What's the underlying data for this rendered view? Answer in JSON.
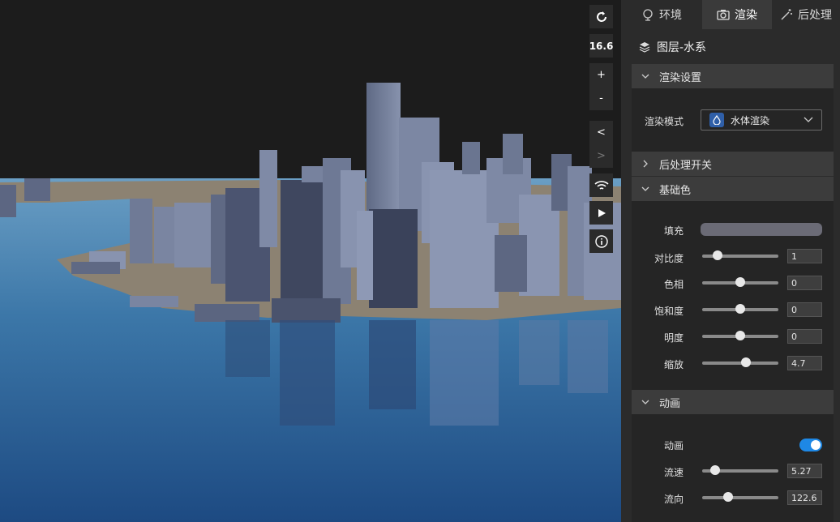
{
  "toolbar": {
    "zoom_level": "16.6",
    "zoom_in": "+",
    "zoom_out": "-",
    "prev": "<",
    "next": ">"
  },
  "tabs": [
    {
      "label": "环境",
      "icon": "globe-icon"
    },
    {
      "label": "渲染",
      "icon": "camera-icon"
    },
    {
      "label": "后处理",
      "icon": "magic-wand-icon"
    }
  ],
  "layer": {
    "title": "图层-水系",
    "icon": "layers-icon"
  },
  "sections": {
    "render_settings": "渲染设置",
    "post_toggle": "后处理开关",
    "base_color": "基础色",
    "animation": "动画"
  },
  "render_mode": {
    "label": "渲染模式",
    "value": "水体渲染",
    "icon": "water-drop-icon"
  },
  "base_color": {
    "fill_label": "填充",
    "fill_color": "#6b6b76",
    "contrast": {
      "label": "对比度",
      "value": "1",
      "fraction": 0.2
    },
    "hue": {
      "label": "色相",
      "value": "0",
      "fraction": 0.5
    },
    "saturation": {
      "label": "饱和度",
      "value": "0",
      "fraction": 0.5
    },
    "brightness": {
      "label": "明度",
      "value": "0",
      "fraction": 0.5
    },
    "scale": {
      "label": "缩放",
      "value": "4.7",
      "fraction": 0.57
    }
  },
  "animation": {
    "toggle_label": "动画",
    "enabled": true,
    "speed": {
      "label": "流速",
      "value": "5.27",
      "fraction": 0.17
    },
    "direction": {
      "label": "流向",
      "value": "122.6",
      "fraction": 0.34
    }
  },
  "colors": {
    "accent": "#1e88e5",
    "panel": "#2b2b2b",
    "section": "#3c3c3c"
  }
}
